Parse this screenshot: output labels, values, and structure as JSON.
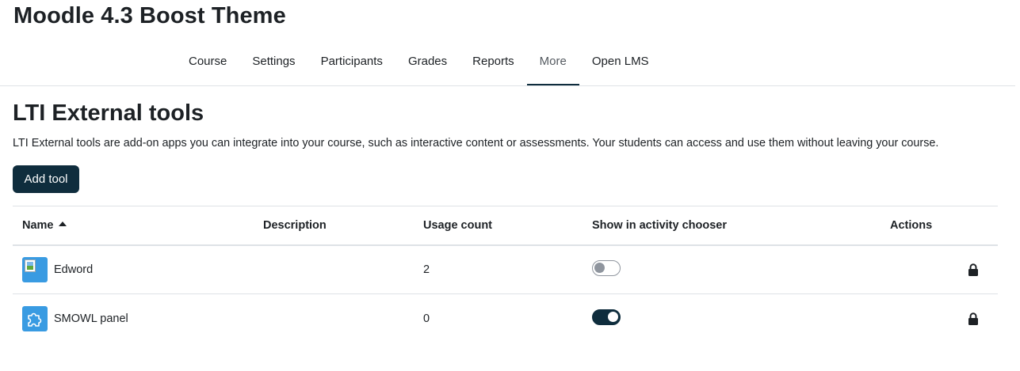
{
  "site": {
    "title": "Moodle 4.3 Boost Theme"
  },
  "nav": {
    "items": [
      {
        "label": "Course"
      },
      {
        "label": "Settings"
      },
      {
        "label": "Participants"
      },
      {
        "label": "Grades"
      },
      {
        "label": "Reports"
      },
      {
        "label": "More",
        "active": true
      },
      {
        "label": "Open LMS"
      }
    ]
  },
  "page": {
    "heading": "LTI External tools",
    "description": "LTI External tools are add-on apps you can integrate into your course, such as interactive content or assessments. Your students can access and use them without leaving your course.",
    "add_button": "Add tool"
  },
  "table": {
    "headers": {
      "name": "Name",
      "description": "Description",
      "usage": "Usage count",
      "show": "Show in activity chooser",
      "actions": "Actions"
    },
    "sort": {
      "column": "name",
      "direction": "ascending"
    },
    "rows": [
      {
        "name": "Edword",
        "description": "",
        "usage": "2",
        "show_in_chooser": false,
        "icon": "broken-image-icon",
        "action_icon": "lock-icon"
      },
      {
        "name": "SMOWL panel",
        "description": "",
        "usage": "0",
        "show_in_chooser": true,
        "icon": "puzzle-icon",
        "action_icon": "lock-icon"
      }
    ]
  },
  "colors": {
    "primary": "#0f2d3d",
    "text": "#1d2125",
    "border": "#dee2e6",
    "tool_icon_bg": "#399be2",
    "toggle_off": "#8f959e"
  }
}
